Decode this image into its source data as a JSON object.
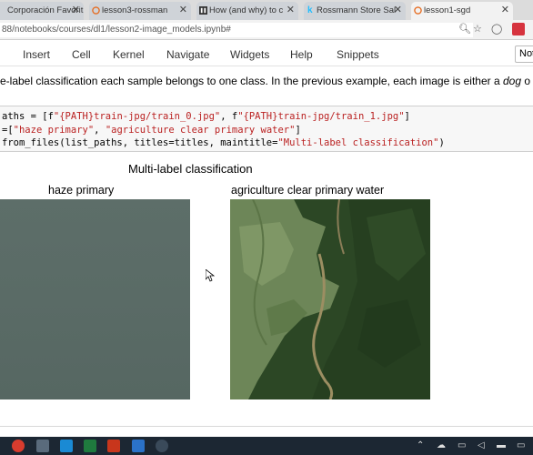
{
  "browser": {
    "tabs": [
      {
        "label": "Corporación Favorit",
        "active": false
      },
      {
        "label": "lesson3-rossman",
        "active": false
      },
      {
        "label": "How (and why) to c",
        "active": false
      },
      {
        "label": "Rossmann Store Sal",
        "active": false
      },
      {
        "label": "lesson1-sgd",
        "active": true
      }
    ],
    "url": "88/notebooks/courses/dl1/lesson2-image_models.ipynb#"
  },
  "jupyter": {
    "menu": [
      "Insert",
      "Cell",
      "Kernel",
      "Navigate",
      "Widgets",
      "Help",
      "Snippets"
    ],
    "kernel_label": "Not"
  },
  "markdown": {
    "text_before": "e-label classification each sample belongs to one class. In the previous example, each image is either a ",
    "italic": "dog",
    "text_after": " o"
  },
  "code": {
    "line1": {
      "a": "aths = [f",
      "s1": "\"{PATH}train-jpg/train_0.jpg\"",
      "b": ", f",
      "s2": "\"{PATH}train-jpg/train_1.jpg\"",
      "c": "]"
    },
    "line2": {
      "a": "=[",
      "s1": "\"haze primary\"",
      "b": ", ",
      "s2": "\"agriculture clear primary water\"",
      "c": "]"
    },
    "line3": {
      "a": "from_files(list_paths, titles=titles, maintitle=",
      "s1": "\"Multi-label classification\"",
      "c": ")"
    }
  },
  "output": {
    "main_title": "Multi-label classification",
    "left_title": "haze primary",
    "right_title": "agriculture clear primary water"
  },
  "colors": {
    "string": "#ba2121",
    "taskbar": "#1c2733"
  }
}
